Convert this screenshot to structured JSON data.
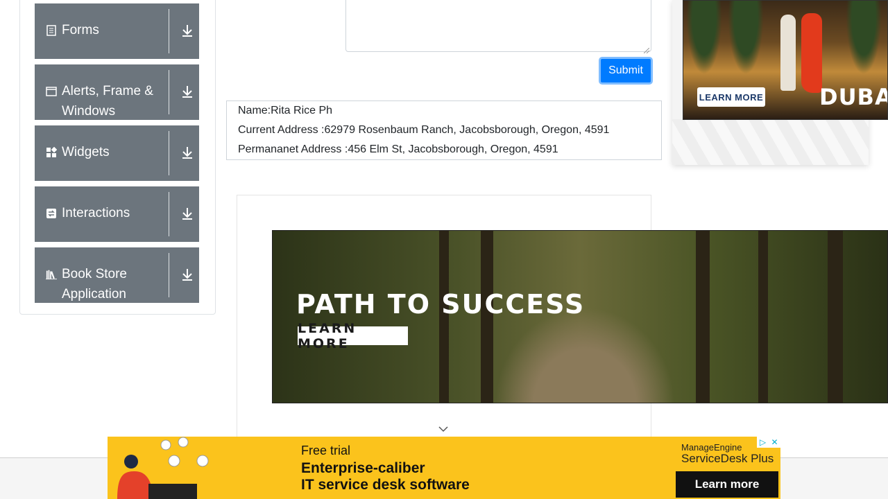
{
  "sidebar": {
    "groups": [
      {
        "label": "Forms",
        "icon": "form-icon"
      },
      {
        "label": "Alerts, Frame & Windows",
        "icon": "window-icon"
      },
      {
        "label": "Widgets",
        "icon": "widgets-icon"
      },
      {
        "label": "Interactions",
        "icon": "interactions-icon"
      },
      {
        "label": "Book Store Application",
        "icon": "books-icon"
      }
    ]
  },
  "form": {
    "submit_label": "Submit"
  },
  "output": {
    "name": "Name:Rita Rice Ph",
    "current_address": "Current Address :62979 Rosenbaum Ranch, Jacobsborough, Oregon, 4591",
    "permanent_address": "Permananet Address :456 Elm St, Jacobsborough, Oregon, 4591"
  },
  "ads": {
    "dubai": {
      "cta": "LEARN MORE",
      "brand": "DUBAI"
    },
    "forest": {
      "headline": "PATH TO SUCCESS",
      "cta": "LEARN MORE"
    },
    "servicedesk": {
      "line1": "Free trial",
      "line2": "Enterprise-caliber",
      "line3": "IT service desk software",
      "vendor": "ManageEngine",
      "product": "ServiceDesk Plus",
      "cta": "Learn more"
    }
  },
  "colors": {
    "sidebar_group_bg": "#6c757d",
    "submit_bg": "#007bff",
    "ad_yellow": "#fbc31c"
  }
}
